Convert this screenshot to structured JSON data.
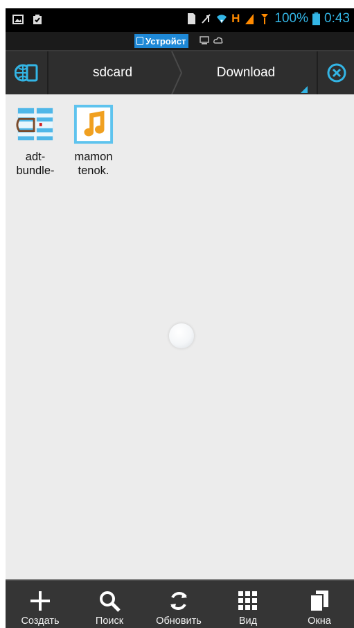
{
  "status_bar": {
    "battery": "100%",
    "time": "0:43",
    "network": "H",
    "icons": [
      "image-icon",
      "clipboard-check-icon",
      "sd-card-icon",
      "signal-mute-icon",
      "wifi-icon",
      "h-network-icon",
      "cellular-signal-icon",
      "battery-icon"
    ]
  },
  "storage": {
    "active_label": "Устройст",
    "icons": [
      "phone-icon",
      "computer-icon",
      "cloud-icon"
    ]
  },
  "path_bar": {
    "segments": [
      "sdcard",
      "Download"
    ],
    "icons": [
      "storage-toggle-icon",
      "close-circle-icon"
    ]
  },
  "files": [
    {
      "name_line1": "adt-",
      "name_line2": "bundle-",
      "icon": "archive-icon"
    },
    {
      "name_line1": "mamon",
      "name_line2": "tenok.",
      "icon": "music-note-icon"
    }
  ],
  "toolbar": {
    "create": "Создать",
    "search": "Поиск",
    "refresh": "Обновить",
    "view": "Вид",
    "windows": "Окна"
  },
  "colors": {
    "accent": "#33b5e5",
    "network": "#ff8a00",
    "storage_tab": "#1e88d6",
    "background": "#ececec",
    "toolbar": "#353535"
  }
}
